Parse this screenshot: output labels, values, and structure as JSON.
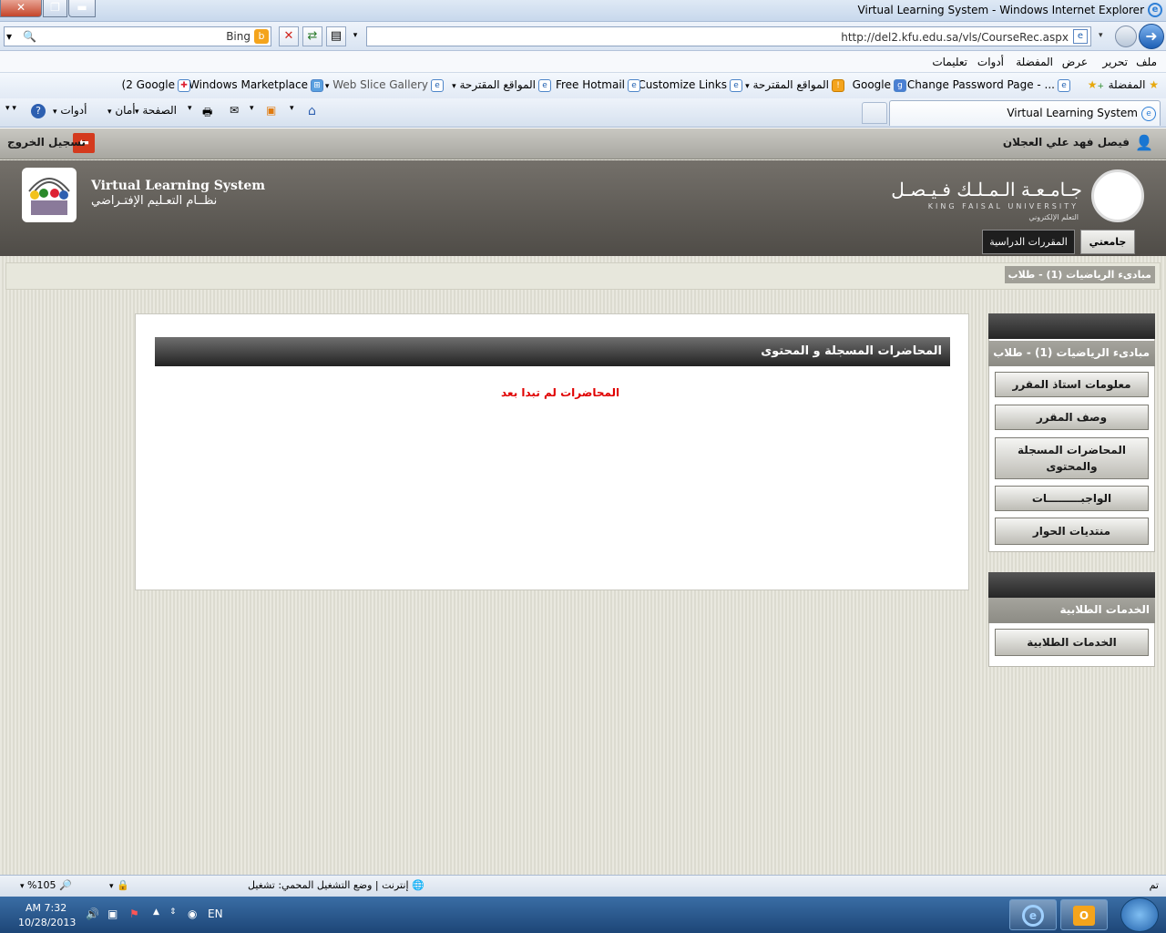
{
  "window": {
    "title": "Virtual Learning System - Windows Internet Explorer"
  },
  "address": {
    "url": "http://del2.kfu.edu.sa/vls/CourseRec.aspx",
    "search_label": "Bing"
  },
  "menu": [
    "ملف",
    "تحرير",
    "عرض",
    "المفضلة",
    "أدوات",
    "تعليمات"
  ],
  "favorites": {
    "label": "المفضلة",
    "items": [
      "Change Password Page - ...",
      "Google",
      "المواقع المقترحة",
      "Customize Links",
      "Free Hotmail",
      "المواقع المقترحة",
      "Web Slice Gallery",
      "Windows Marketplace",
      "(2 Google"
    ]
  },
  "tab": {
    "label": "Virtual Learning System"
  },
  "commands": {
    "page": "الصفحة",
    "safety": "أمان",
    "tools": "أدوات"
  },
  "user": {
    "name": "فيصل فهد علي العجلان",
    "logout": "تسجيل الخروج"
  },
  "header": {
    "vls_en": "Virtual Learning System",
    "vls_ar": "نظــام التعـليم الإفتـراضي",
    "kfu_ar": "جـامـعـة الـمـلـك فـيـصـل",
    "kfu_en": "KING FAISAL UNIVERSITY",
    "kfu_sub": "التعلم الإلكتروني"
  },
  "nav_tabs": {
    "my": "جامعتي",
    "courses": "المقررات الدراسية"
  },
  "breadcrumb": "مبادىء الرياضيات (1) - طلاب",
  "main": {
    "title": "المحاضرات المسجلة و المحتوى",
    "empty": "المحاضرات لم تبدا بعد"
  },
  "sidebar": {
    "course_title": "مبادىء الرياضيات (1) - طلاب",
    "course_items": [
      "معلومات استاذ المقرر",
      "وصف المقرر",
      "المحاضرات المسجلة والمحتوى",
      "الواجبـــــــــات",
      "منتديات الحوار"
    ],
    "services_title": "الخدمات الطلابية",
    "services_items": [
      "الخدمات الطلابية"
    ]
  },
  "status": {
    "done": "تم",
    "zone": "إنترنت | وضع التشغيل المحمي: تشغيل",
    "zoom": "%105"
  },
  "taskbar": {
    "time": "AM 7:32",
    "date": "10/28/2013",
    "lang": "EN"
  }
}
